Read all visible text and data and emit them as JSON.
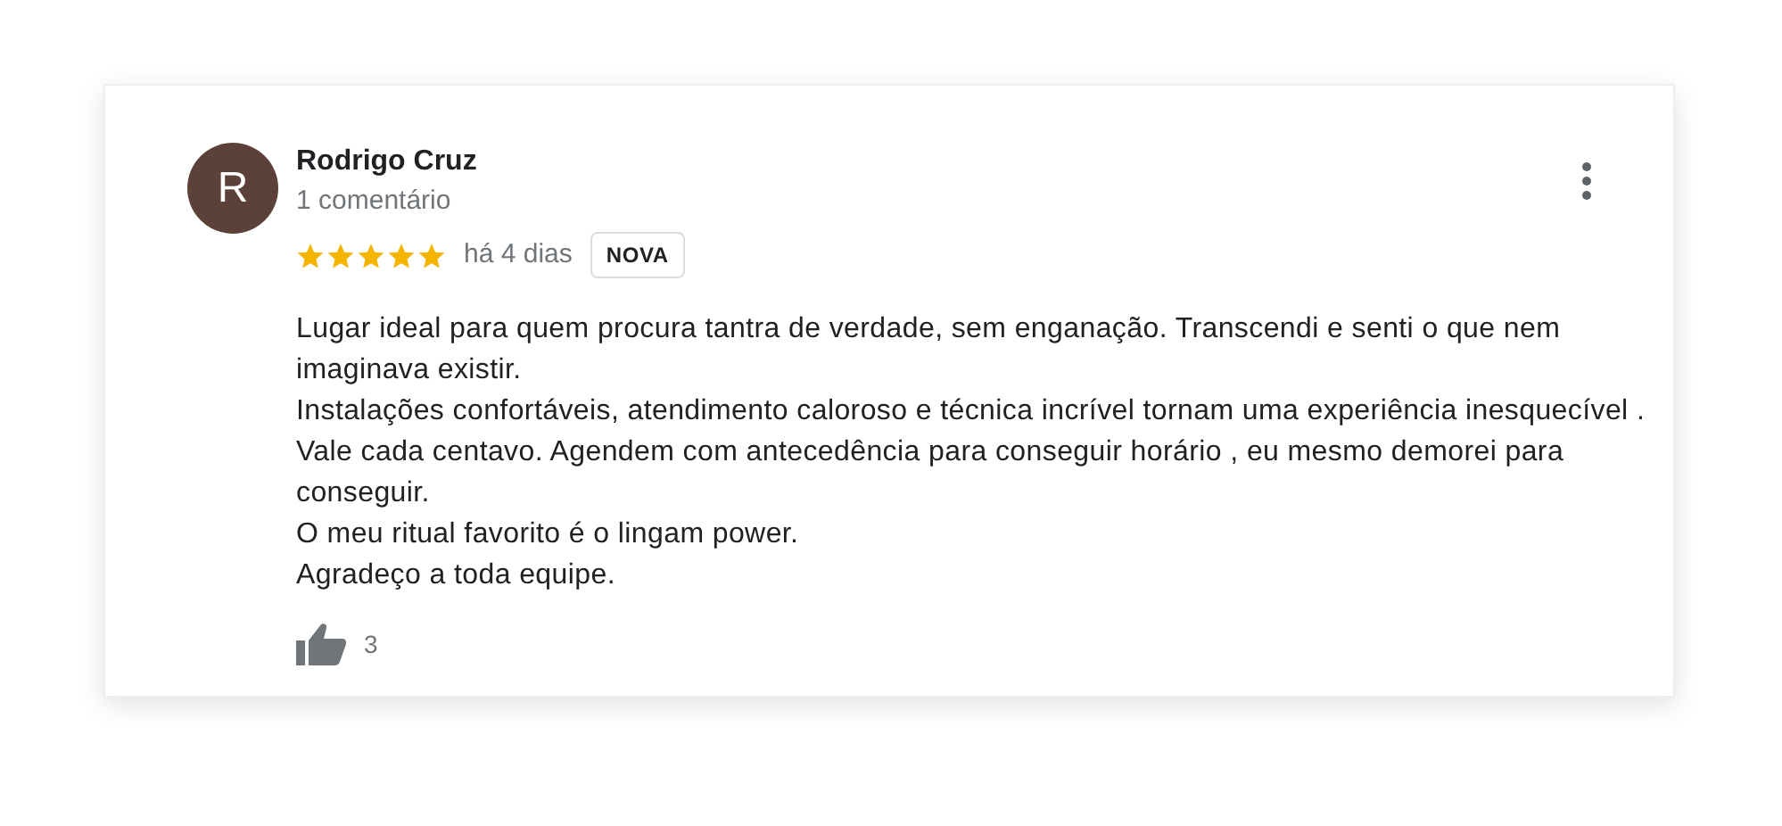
{
  "review": {
    "avatar_letter": "R",
    "author": "Rodrigo Cruz",
    "meta": "1 comentário",
    "stars": 5,
    "time": "há 4 dias",
    "badge": "NOVA",
    "paragraphs": [
      "Lugar ideal para quem procura tantra de verdade, sem enganação. Transcendi e senti o que nem imaginava existir.",
      "Instalações confortáveis, atendimento caloroso e técnica incrível tornam uma experiência inesquecível .",
      "Vale cada centavo. Agendem com antecedência para conseguir horário , eu mesmo demorei para conseguir.",
      "O meu ritual favorito é o lingam power.",
      "Agradeço a toda equipe."
    ],
    "likes": "3"
  }
}
